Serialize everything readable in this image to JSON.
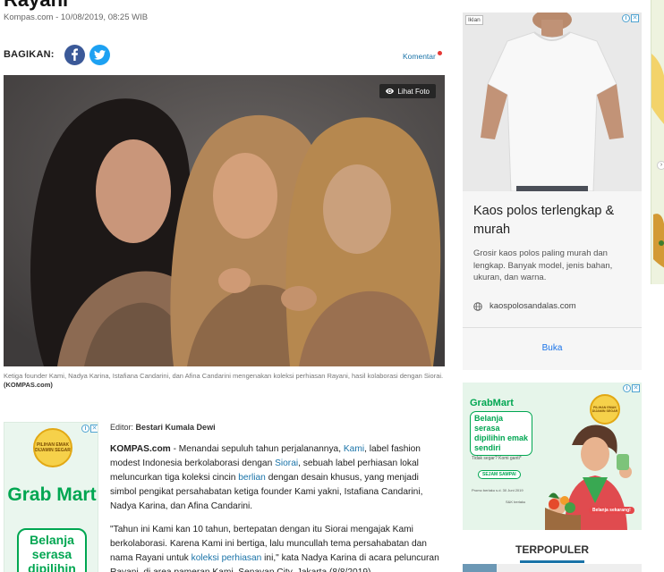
{
  "article": {
    "title_fragment": "Rayani",
    "meta": "Kompas.com - 10/08/2019, 08:25 WIB",
    "share_label": "BAGIKAN:",
    "comment_label": "Komentar",
    "photo_button": "Lihat Foto",
    "caption": "Ketiga founder Kami, Nadya Karina, Istafiana Candarini, dan Afina Candarini mengenakan koleksi perhiasan Rayani, hasil kolaborasi dengan Siorai.",
    "caption_credit": "(KOMPAS.com)",
    "editor_label": "Editor:",
    "editor_name": "Bestari Kumala Dewi",
    "p1": {
      "brand": "KOMPAS.com",
      "t1": " - Menandai sepuluh tahun perjalanannya, ",
      "link1": "Kami",
      "t2": ", label fashion modest Indonesia berkolaborasi dengan ",
      "link2": "Siorai",
      "t3": ", sebuah label perhiasan lokal meluncurkan tiga koleksi cincin ",
      "link3": "berlian",
      "t4": " dengan desain khusus, yang menjadi simbol pengikat persahabatan ketiga founder Kami yakni, Istafiana Candarini, Nadya Karina, dan Afina Candarini."
    },
    "p2": {
      "t1": "\"Tahun ini Kami kan 10 tahun, bertepatan dengan itu Siorai mengajak Kami berkolaborasi. Karena Kami ini bertiga, lalu muncullah tema persahabatan dan nama Rayani untuk ",
      "link1": "koleksi perhiasan",
      "t2": " ini,\" kata Nadya Karina di acara peluncuran Rayani, di area pameran Kami, Senayan City, Jakarta (8/8/2019)."
    }
  },
  "ads": {
    "left": {
      "seal": "PILIHAN EMAK DIJAMIN SEGAR",
      "logo": "Grab Mart",
      "tagline": "Belanja serasa dipilihin"
    },
    "right": {
      "badge": "Iklan",
      "headline": "Kaos polos terlengkap & murah",
      "description": "Grosir kaos polos paling murah dan lengkap. Banyak model, jenis bahan, ukuran, dan warna.",
      "domain": "kaospolosandalas.com",
      "cta": "Buka"
    },
    "grab": {
      "logo": "GrabMart",
      "tagline": "Belanja serasa dipilihin emak sendiri",
      "small_text": "Tidak segar? Komi ganti*",
      "pill": "SEJAM SAMPAI",
      "tiny_text": "Promo berlaku s.d. 30 Juni 2019",
      "tiny_text2": "S&K berlaku",
      "cta": "Belanja sekarang!",
      "seal": "PILIHAN EMAK DIJAMIN SEGAR"
    }
  },
  "sidebar": {
    "section_title": "TERPOPULER"
  },
  "colors": {
    "link": "#1a73a8",
    "facebook": "#3b5998",
    "twitter": "#1da1f2",
    "grab_green": "#00a651"
  }
}
